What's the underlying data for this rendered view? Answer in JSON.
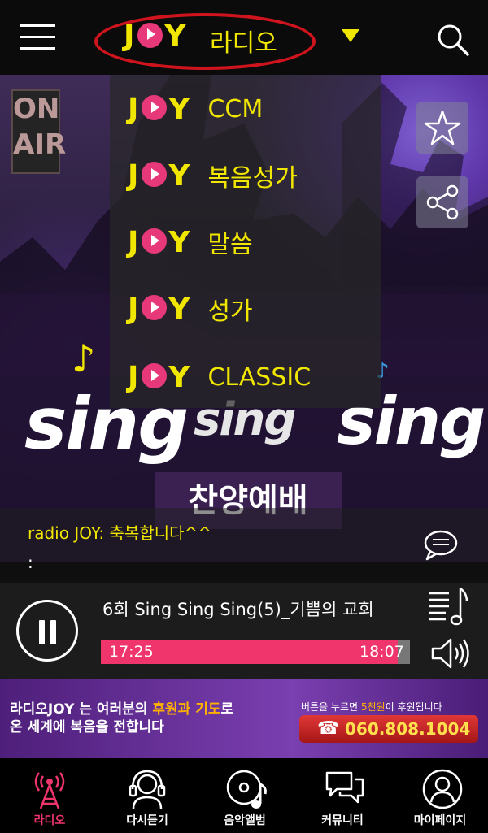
{
  "header": {
    "brand": "JOY",
    "channel": "라디오",
    "colors": {
      "accent": "#f1e600",
      "highlight": "#d0141d"
    }
  },
  "dropdown": {
    "items": [
      {
        "label": "CCM"
      },
      {
        "label": "복음성가"
      },
      {
        "label": "말씀"
      },
      {
        "label": "성가"
      },
      {
        "label": "CLASSIC"
      }
    ]
  },
  "hero": {
    "onair": "ON AIR",
    "program_words": [
      "sing",
      "sing",
      "sing"
    ],
    "program_subtitle": "찬양예배"
  },
  "chat": {
    "message": "radio JOY: 축복합니다^^",
    "input": ":"
  },
  "player": {
    "track_title": "6회 Sing Sing Sing(5)_기쁨의 교회",
    "current_time": "17:25",
    "total_time": "18:07",
    "progress_fraction": 0.96,
    "state": "playing",
    "progress_color": "#f0346c"
  },
  "banner": {
    "line1_a": "라디오JOY 는 여러분의 ",
    "line1_hl": "후원과 기도",
    "line1_b": "로",
    "line2": "온 세계에 복음을 전합니다",
    "right_a": "버튼을 누르면 ",
    "right_hl": "5천원",
    "right_b": "이 후원됩니다",
    "phone": "060.808.1004"
  },
  "tabs": [
    {
      "label": "라디오",
      "icon": "radio-tower-icon",
      "active": true
    },
    {
      "label": "다시듣기",
      "icon": "headset-icon",
      "active": false
    },
    {
      "label": "음악앨범",
      "icon": "music-album-icon",
      "active": false
    },
    {
      "label": "커뮤니티",
      "icon": "chat-bubbles-icon",
      "active": false
    },
    {
      "label": "마이페이지",
      "icon": "user-profile-icon",
      "active": false
    }
  ]
}
